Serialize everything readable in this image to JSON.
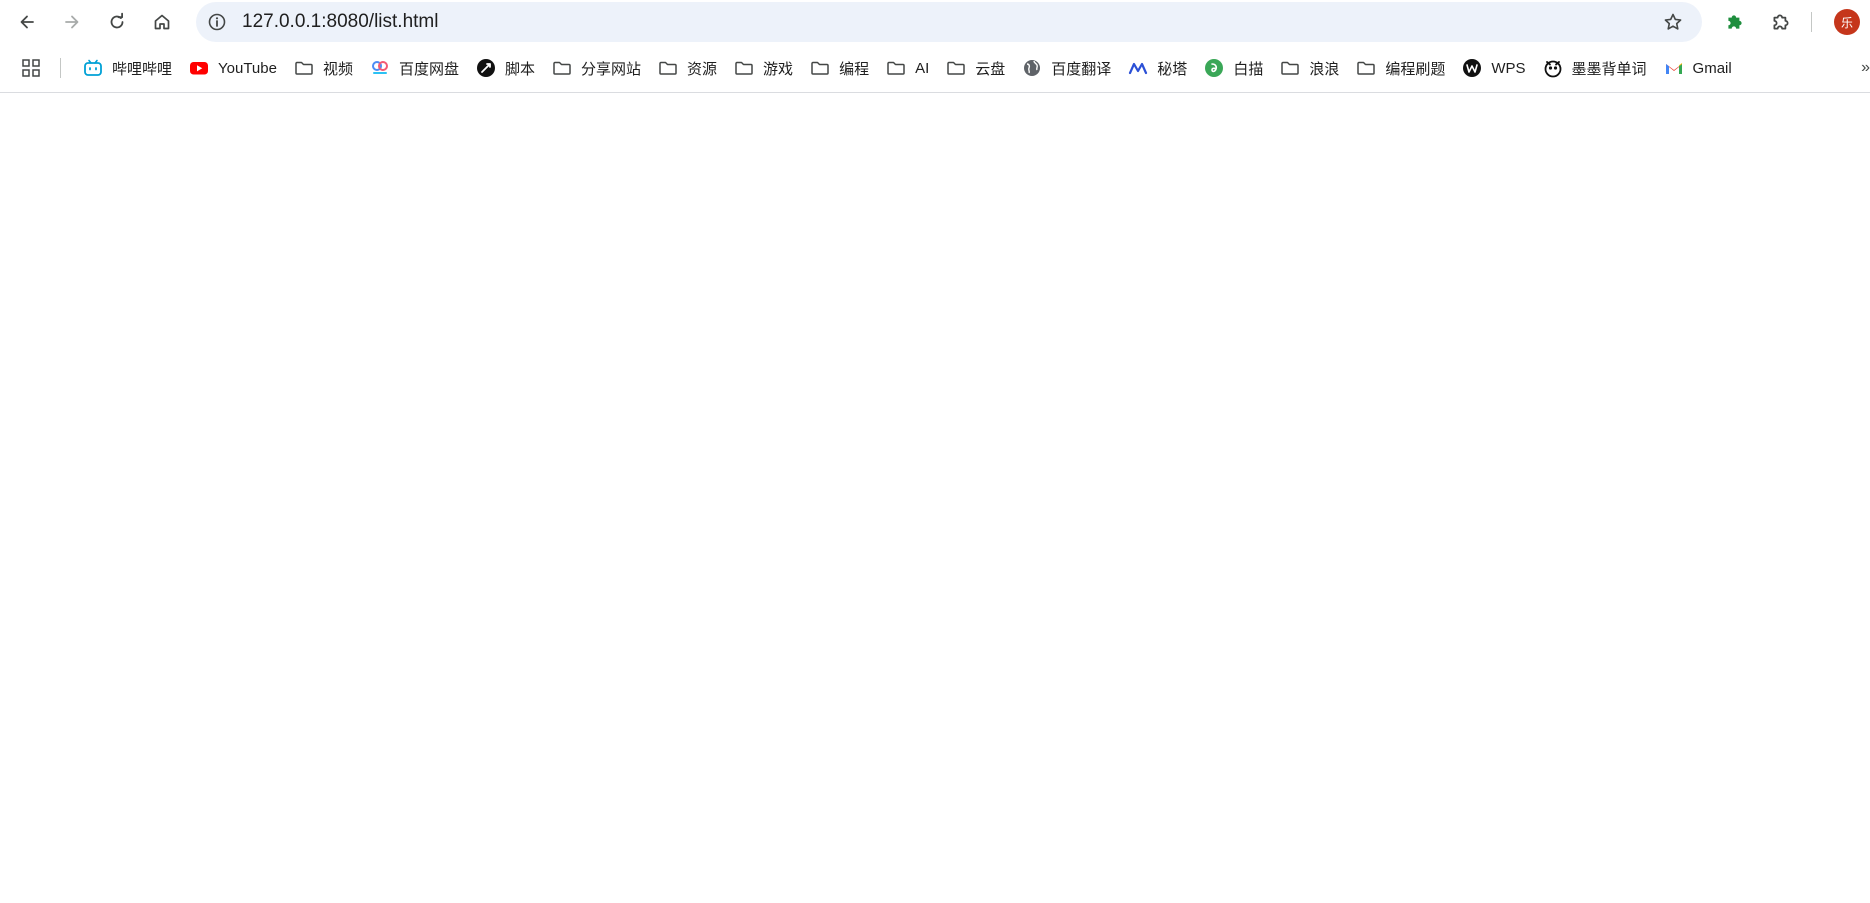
{
  "browser": {
    "url": "127.0.0.1:8080/list.html",
    "profile_initial": "乐",
    "colors": {
      "omnibox_bg": "#edf2fa",
      "avatar_bg": "#c5361b",
      "extension_icon": "#1e8e3e"
    }
  },
  "bookmarks": [
    {
      "label": "哔哩哔哩",
      "icon": "bilibili-icon"
    },
    {
      "label": "YouTube",
      "icon": "youtube-icon"
    },
    {
      "label": "视频",
      "icon": "folder-icon"
    },
    {
      "label": "百度网盘",
      "icon": "baidu-netdisk-icon"
    },
    {
      "label": "脚本",
      "icon": "script-icon"
    },
    {
      "label": "分享网站",
      "icon": "folder-icon"
    },
    {
      "label": "资源",
      "icon": "folder-icon"
    },
    {
      "label": "游戏",
      "icon": "folder-icon"
    },
    {
      "label": "编程",
      "icon": "folder-icon"
    },
    {
      "label": "AI",
      "icon": "folder-icon"
    },
    {
      "label": "云盘",
      "icon": "folder-icon"
    },
    {
      "label": "百度翻译",
      "icon": "globe-icon"
    },
    {
      "label": "秘塔",
      "icon": "metaso-icon"
    },
    {
      "label": "白描",
      "icon": "baimiao-icon"
    },
    {
      "label": "浪浪",
      "icon": "folder-icon"
    },
    {
      "label": "编程刷题",
      "icon": "folder-icon"
    },
    {
      "label": "WPS",
      "icon": "wps-icon"
    },
    {
      "label": "墨墨背单词",
      "icon": "momo-icon"
    },
    {
      "label": "Gmail",
      "icon": "gmail-icon"
    }
  ]
}
